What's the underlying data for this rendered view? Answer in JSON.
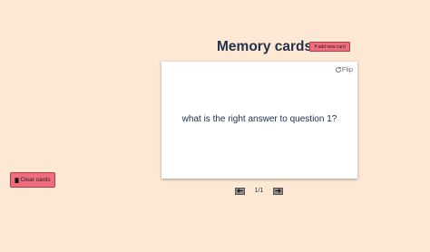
{
  "header": {
    "title": "Memory cards",
    "add_card_label": "add new card"
  },
  "card": {
    "flip_label": "Flip",
    "question": "what is the right answer to question 1?"
  },
  "pager": {
    "indicator": "1/1"
  },
  "sidebar": {
    "clear_cards_label": "Clear cards"
  },
  "icons": {
    "add": "plus-icon",
    "flip": "refresh-icon",
    "prev": "arrow-left-icon",
    "next": "arrow-right-icon",
    "clear": "trash-icon"
  },
  "colors": {
    "background": "#fde8d4",
    "accent_button": "#ee6d7d",
    "title_text": "#23314a",
    "card_background": "#ffffff",
    "nav_button": "#8c8c8c"
  }
}
